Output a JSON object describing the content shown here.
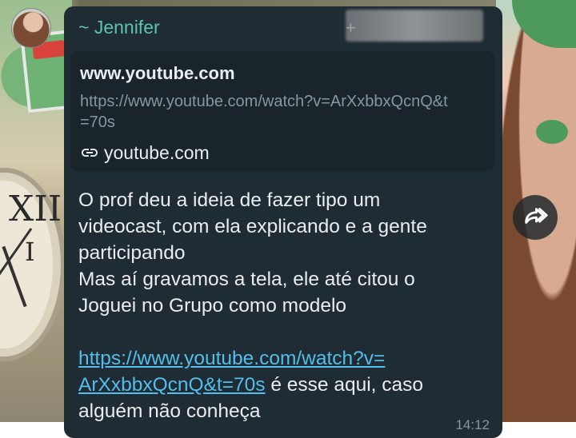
{
  "message": {
    "sender": "~ Jennifer",
    "sender_phone_prefix": "+",
    "link_preview": {
      "title": "www.youtube.com",
      "url": "https://www.youtube.com/watch?v=ArXxbbxQcnQ&t=70s",
      "url_line1": "https://www.youtube.com/watch?v=ArXxbbxQcnQ&t",
      "url_line2": "=70s",
      "domain": "youtube.com",
      "icon": "link-icon"
    },
    "text_lines": [
      "O prof deu a ideia de fazer tipo um",
      "videocast, com ela explicando e a gente",
      "participando",
      "Mas aí gravamos a tela, ele até citou o",
      "Joguei no Grupo como modelo"
    ],
    "link_line1": "https://www.youtube.com/watch?v=",
    "link_line2": "ArXxbbxQcnQ&t=70s",
    "link_suffix": " é esse aqui, caso",
    "last_line": "alguém não conheça",
    "time": "14:12"
  },
  "actions": {
    "forward_icon": "forward-icon"
  },
  "colors": {
    "bubble": "#1f2c33",
    "preview": "#1a252b",
    "sender": "#5ec2b0",
    "link": "#53bdeb",
    "text": "#e9edef",
    "muted": "#8696a0"
  }
}
